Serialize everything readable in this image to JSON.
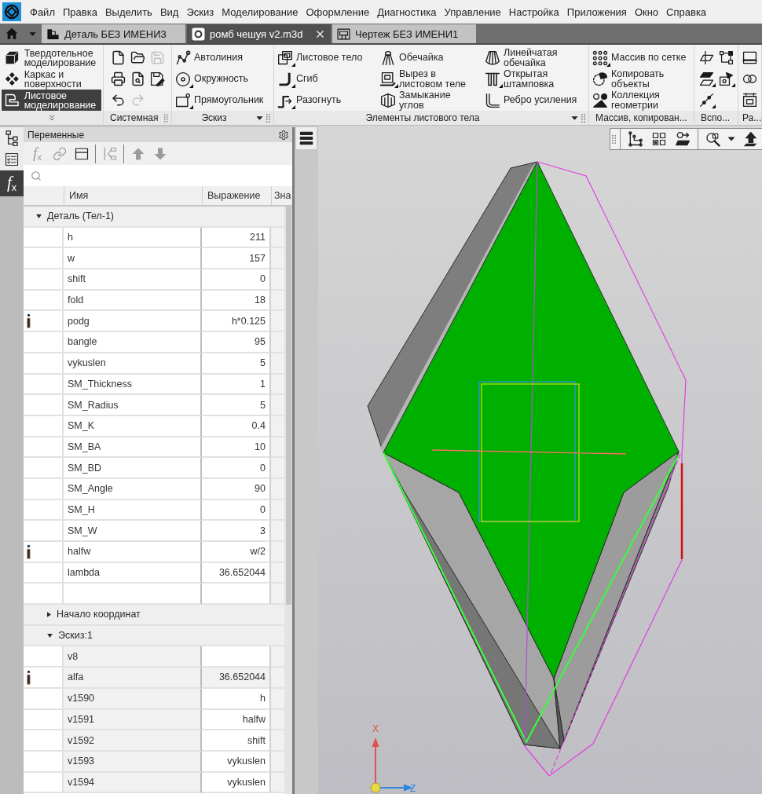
{
  "menu": [
    "Файл",
    "Правка",
    "Выделить",
    "Вид",
    "Эскиз",
    "Моделирование",
    "Оформление",
    "Диагностика",
    "Управление",
    "Настройка",
    "Приложения",
    "Окно",
    "Справка"
  ],
  "documents": [
    {
      "title": "Деталь БЕЗ ИМЕНИ3",
      "kind": "part",
      "selected": false
    },
    {
      "title": "ромб чешуя v2.m3d",
      "kind": "model",
      "selected": true
    },
    {
      "title": "Чертеж БЕЗ ИМЕНИ1",
      "kind": "drawing",
      "selected": false
    }
  ],
  "modes": [
    {
      "label": "Твердотельное моделирование",
      "selected": false
    },
    {
      "label": "Каркас и поверхности",
      "selected": false
    },
    {
      "label": "Листовое моделирование",
      "selected": true
    }
  ],
  "ribbon_groups": [
    {
      "label": "Системная",
      "kind": "icons",
      "dropdown": false,
      "columns": [
        [
          {
            "disabled": false,
            "submenu": false
          },
          {
            "disabled": false,
            "submenu": false
          },
          {
            "disabled": false,
            "submenu": false
          }
        ],
        [
          {
            "disabled": false,
            "submenu": false
          },
          {
            "disabled": false,
            "submenu": false
          },
          {
            "disabled": true,
            "submenu": false
          }
        ],
        [
          {
            "disabled": true,
            "submenu": false
          },
          {
            "disabled": false,
            "submenu": false
          }
        ]
      ]
    },
    {
      "label": "Эскиз",
      "kind": "labeled",
      "dropdown": true,
      "columns": [
        [
          {
            "label": "Автолиния",
            "submenu": false
          },
          {
            "label": "Окружность",
            "submenu": true
          },
          {
            "label": "Прямоугольник",
            "submenu": true
          }
        ]
      ]
    },
    {
      "label": "Элементы листового тела",
      "kind": "labeled",
      "dropdown": true,
      "columns": [
        [
          {
            "label": "Листовое тело",
            "submenu": true
          },
          {
            "label": "Сгиб",
            "submenu": true
          },
          {
            "label": "Разогнуть",
            "submenu": true
          }
        ],
        [
          {
            "label": "Обечайка",
            "submenu": false
          },
          {
            "label": "Вырез в листовом теле",
            "submenu": true
          },
          {
            "label": "Замыкание углов",
            "submenu": false
          }
        ],
        [
          {
            "label": "Линейчатая обечайка",
            "submenu": false
          },
          {
            "label": "Открытая штамповка",
            "submenu": true
          },
          {
            "label": "Ребро усиления",
            "submenu": false
          }
        ]
      ]
    },
    {
      "label": "Массив, копирован...",
      "kind": "labeled",
      "dropdown": false,
      "columns": [
        [
          {
            "label": "Массив по сетке",
            "submenu": true
          },
          {
            "label": "Копировать объекты",
            "submenu": false
          },
          {
            "label": "Коллекция геометрии",
            "submenu": false
          }
        ]
      ]
    },
    {
      "label": "Вспо...",
      "kind": "icons",
      "dropdown": false,
      "columns": [
        [
          {
            "disabled": false,
            "submenu": false
          },
          {
            "disabled": false,
            "submenu": true
          },
          {
            "disabled": false,
            "submenu": true
          }
        ],
        [
          {
            "disabled": false,
            "submenu": false
          },
          {
            "disabled": false,
            "submenu": true
          }
        ]
      ]
    },
    {
      "label": "Ра...",
      "kind": "icons",
      "columns": [
        [
          {
            "disabled": false,
            "submenu": false
          },
          {
            "disabled": false,
            "submenu": false
          },
          {
            "disabled": false,
            "submenu": false
          }
        ]
      ]
    }
  ],
  "side_tabs": [
    {
      "kind": "icon",
      "selected": false
    },
    {
      "kind": "icon",
      "selected": false
    },
    {
      "kind": "text",
      "label": "*f*$_{x}$",
      "selected": true
    }
  ],
  "panel": {
    "title": "Переменные",
    "toolbar": [
      [
        {
          "kind": "text",
          "label": "*f*$_{x}$",
          "disabled": true
        },
        {
          "kind": "icon",
          "disabled": true
        },
        {
          "kind": "icon",
          "disabled": false
        }
      ],
      [
        {
          "kind": "icon",
          "disabled": true
        }
      ],
      [
        {
          "kind": "icon",
          "disabled": true
        },
        {
          "kind": "icon",
          "disabled": true
        }
      ]
    ],
    "columns": [
      "Имя",
      "Выражение",
      "Зна"
    ],
    "tree": [
      {
        "label": "Деталь (Тел-1)",
        "expanded": true,
        "rows": [
          {
            "name": "h",
            "expression": "211",
            "info": false,
            "readonly": false
          },
          {
            "name": "w",
            "expression": "157",
            "info": false,
            "readonly": false
          },
          {
            "name": "shift",
            "expression": "0",
            "info": false,
            "readonly": false
          },
          {
            "name": "fold",
            "expression": "18",
            "info": false,
            "readonly": false
          },
          {
            "name": "podg",
            "expression": "h*0.125",
            "info": true,
            "readonly": false
          },
          {
            "name": "bangle",
            "expression": "95",
            "info": false,
            "readonly": false
          },
          {
            "name": "vykuslen",
            "expression": "5",
            "info": false,
            "readonly": false
          },
          {
            "name": "SM_Thickness",
            "expression": "1",
            "info": false,
            "readonly": false
          },
          {
            "name": "SM_Radius",
            "expression": "5",
            "info": false,
            "readonly": false
          },
          {
            "name": "SM_K",
            "expression": "0.4",
            "info": false,
            "readonly": false
          },
          {
            "name": "SM_BA",
            "expression": "10",
            "info": false,
            "readonly": false
          },
          {
            "name": "SM_BD",
            "expression": "0",
            "info": false,
            "readonly": false
          },
          {
            "name": "SM_Angle",
            "expression": "90",
            "info": false,
            "readonly": false
          },
          {
            "name": "SM_H",
            "expression": "0",
            "info": false,
            "readonly": false
          },
          {
            "name": "SM_W",
            "expression": "3",
            "info": false,
            "readonly": false
          },
          {
            "name": "halfw",
            "expression": "w/2",
            "info": true,
            "readonly": false
          },
          {
            "name": "lambda",
            "expression": "36.652044",
            "info": false,
            "readonly": false
          },
          {
            "info": false,
            "readonly": false
          }
        ],
        "children": [
          {
            "label": "Начало координат",
            "expanded": false
          },
          {
            "label": "Эскиз:1",
            "expanded": true,
            "rows": [
              {
                "name": "v8",
                "info": false,
                "readonly": true
              },
              {
                "name": "alfa",
                "expression": "36.652044",
                "info": true,
                "readonly": true
              },
              {
                "name": "v1590",
                "expression": "h",
                "info": false,
                "readonly": true
              },
              {
                "name": "v1591",
                "expression": "halfw",
                "info": false,
                "readonly": true
              },
              {
                "name": "v1592",
                "expression": "shift",
                "info": false,
                "readonly": true
              },
              {
                "name": "v1593",
                "expression": "vykuslen",
                "info": false,
                "readonly": true
              },
              {
                "name": "v1594",
                "expression": "vykuslen",
                "info": false,
                "readonly": true
              }
            ]
          }
        ]
      }
    ]
  },
  "viewport": {
    "axes": [
      {
        "label": "X",
        "color": "#e0504c"
      },
      {
        "label": "Z",
        "color": "#2e86de"
      }
    ]
  }
}
